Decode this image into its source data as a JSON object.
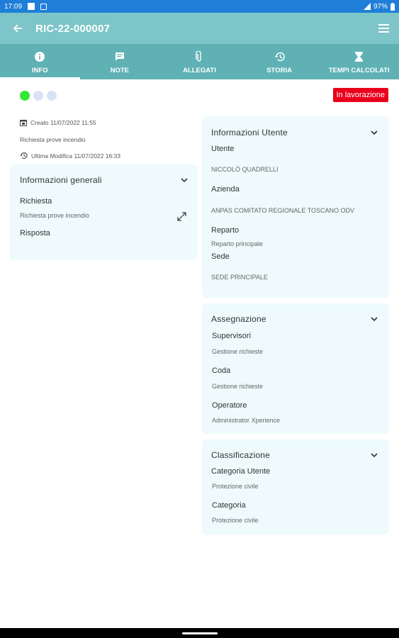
{
  "status_bar": {
    "time": "17:09",
    "battery": "97%"
  },
  "app_bar": {
    "title": "RIC-22-000007"
  },
  "tabs": [
    {
      "label": "INFO"
    },
    {
      "label": "NOTE"
    },
    {
      "label": "ALLEGATI"
    },
    {
      "label": "STORIA"
    },
    {
      "label": "TEMPI CALCOLATI"
    }
  ],
  "colors": {
    "status_dot_active": "#33e833",
    "status_dot_inactive": "#d7e3f5",
    "badge": "#e8001c",
    "tab_bar": "#5fb1b4",
    "app_bar": "#7dc5c9"
  },
  "status_badge": "In lavorazione",
  "meta": {
    "created": "Creato 11/07/2022 11:55",
    "request_title": "Richiesta prove incendio",
    "last_modified": "Ultima Modifica 11/07/2022 16:33"
  },
  "general": {
    "title": "Informazioni generali",
    "request_label": "Richiesta",
    "request_value": "Richiesta prove incendio",
    "response_label": "Risposta"
  },
  "user_info": {
    "title": "Informazioni Utente",
    "user_label": "Utente",
    "user_value": "NICCOLÒ QUADRELLI",
    "company_label": "Azienda",
    "company_value": "ANPAS COMITATO REGIONALE TOSCANO ODV",
    "department_label": "Reparto",
    "department_value": "Reparto principale",
    "site_label": "Sede",
    "site_value": "SEDE PRINCIPALE"
  },
  "assignment": {
    "title": "Assegnazione",
    "supervisors_label": "Supervisori",
    "supervisors_value": "Gestione richieste",
    "queue_label": "Coda",
    "queue_value": "Gestione richieste",
    "operator_label": "Operatore",
    "operator_value": "Administrator Xperience"
  },
  "classification": {
    "title": "Classificazione",
    "user_category_label": "Categoria Utente",
    "user_category_value": "Protezione civile",
    "category_label": "Categoria",
    "category_value": "Protezione civile"
  }
}
